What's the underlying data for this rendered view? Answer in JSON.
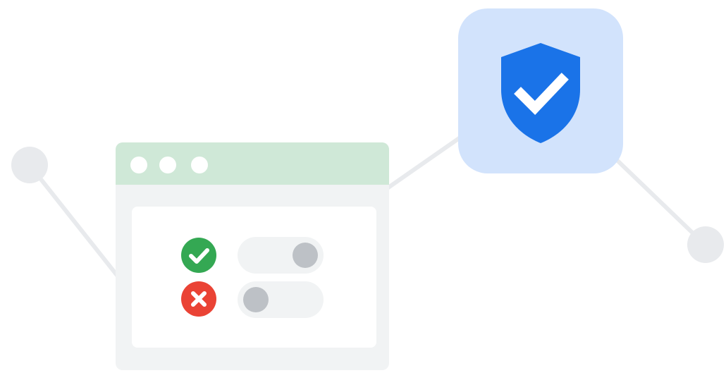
{
  "illustration": {
    "browser_window": {
      "window_dots": 3,
      "rows": [
        {
          "status": "allowed",
          "status_icon": "check-circle-icon",
          "toggle_state": "on"
        },
        {
          "status": "blocked",
          "status_icon": "x-circle-icon",
          "toggle_state": "off"
        }
      ]
    },
    "security_badge": {
      "icon": "shield-check-icon"
    },
    "connection_nodes": 2
  },
  "colors": {
    "background": "#ffffff",
    "connector": "#e8eaed",
    "window_body": "#f1f3f4",
    "title_bar": "#cfe8d7",
    "check_green": "#34a853",
    "error_red": "#ea4335",
    "toggle_track": "#f1f3f4",
    "toggle_knob": "#bdc1c6",
    "tile_background": "#d2e3fc",
    "shield_blue": "#1a73e8"
  }
}
